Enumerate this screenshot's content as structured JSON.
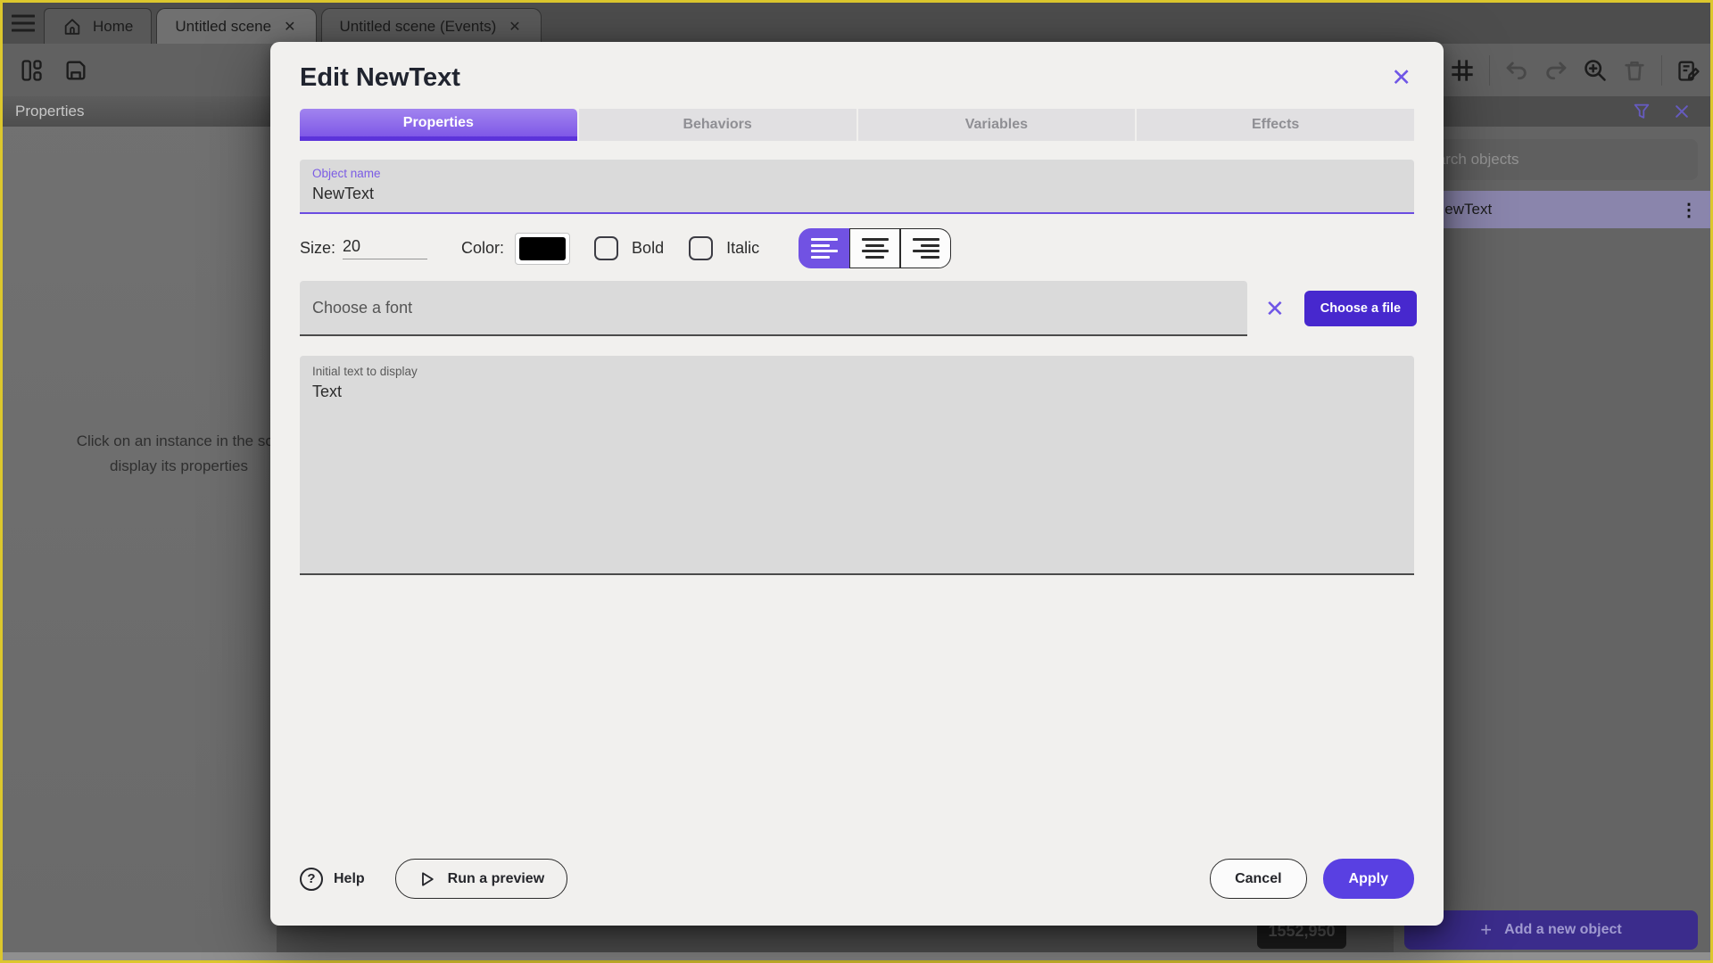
{
  "window": {
    "tabs": [
      {
        "label": "Home"
      },
      {
        "label": "Untitled scene",
        "close": "✕"
      },
      {
        "label": "Untitled scene (Events)",
        "close": "✕"
      }
    ],
    "left_panel": {
      "header": "Properties",
      "empty_text_line1": "Click on an instance in the sce",
      "empty_text_line2": "display its properties"
    },
    "canvas": {
      "coordinates": "1552,950"
    },
    "right_panel": {
      "search_placeholder": "Search objects",
      "object_name": "NewText",
      "kebab": "⋮",
      "add_button_label": "Add a new object",
      "plus": "+"
    }
  },
  "dialog": {
    "title": "Edit NewText",
    "close": "✕",
    "tabs": [
      {
        "label": "Properties",
        "active": true
      },
      {
        "label": "Behaviors",
        "active": false
      },
      {
        "label": "Variables",
        "active": false
      },
      {
        "label": "Effects",
        "active": false
      }
    ],
    "object_name": {
      "label": "Object name",
      "value": "NewText"
    },
    "size": {
      "label": "Size:",
      "value": "20"
    },
    "color": {
      "label": "Color:",
      "value": "#000000"
    },
    "bold": {
      "label": "Bold",
      "checked": false
    },
    "italic": {
      "label": "Italic",
      "checked": false
    },
    "alignment": {
      "selected": "left"
    },
    "font": {
      "placeholder": "Choose a font",
      "clear": "✕",
      "button_label": "Choose a file"
    },
    "initial_text": {
      "label": "Initial text to display",
      "value": "Text"
    },
    "footer": {
      "help_label": "Help",
      "preview_label": "Run a preview",
      "cancel_label": "Cancel",
      "apply_label": "Apply"
    }
  },
  "colors": {
    "window_border": "#dcc72d",
    "accent_purple": "#7152e3",
    "deep_purple": "#4728ce",
    "apply_purple": "#5940e2",
    "selected_row": "#8a85ac",
    "swatch_color": "#000000"
  }
}
